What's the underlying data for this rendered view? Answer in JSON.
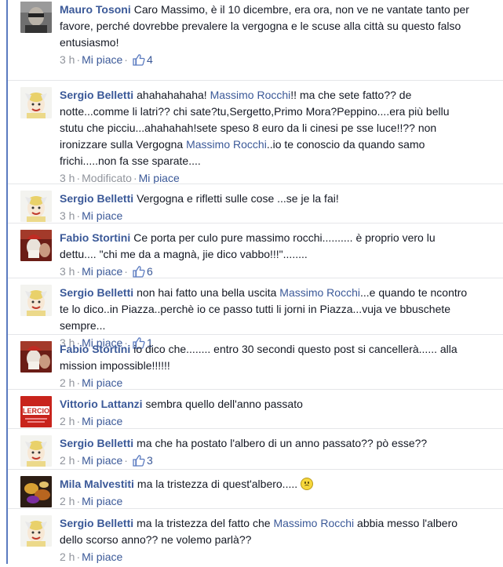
{
  "like_label": "Mi piace",
  "comments": [
    {
      "avatar": "mauro-avatar",
      "author": "Mauro Tosoni",
      "segments": [
        {
          "t": "Caro Massimo, è il 10 dicembre, era ora, non ve ne vantate tanto per favore, perché dovrebbe prevalere la vergogna e le scuse alla città su questo falso entusiasmo!",
          "m": false
        }
      ],
      "time": "3 h",
      "edited": "",
      "likes": "4"
    },
    {
      "avatar": "sergio-avatar",
      "author": "Sergio Belletti",
      "segments": [
        {
          "t": "ahahahahaha! ",
          "m": false
        },
        {
          "t": "Massimo Rocchi",
          "m": true
        },
        {
          "t": "!! ma che sete fatto?? de notte...comme li latri?? chi sate?tu,Sergetto,Primo Mora?Peppino....era più bellu stutu che picciu...ahahahah!sete speso 8 euro da li cinesi pe sse luce!!?? non ironizzare sulla Vergogna ",
          "m": false
        },
        {
          "t": "Massimo Rocchi",
          "m": true
        },
        {
          "t": "..io te conoscio da quando samo frichi.....non fa sse sparate....",
          "m": false
        }
      ],
      "time": "3 h",
      "edited": "Modificato",
      "likes": ""
    },
    {
      "avatar": "sergio-avatar",
      "author": "Sergio Belletti",
      "segments": [
        {
          "t": "Vergogna e rifletti sulle cose ...se je la fai!",
          "m": false
        }
      ],
      "time": "3 h",
      "edited": "",
      "likes": ""
    },
    {
      "avatar": "fabio-avatar",
      "author": "Fabio Stortini",
      "segments": [
        {
          "t": "Ce porta per culo pure massimo rocchi.......... è proprio vero lu dettu.... \"chi me da a magnà, jie dico vabbo!!!\"........",
          "m": false
        }
      ],
      "time": "3 h",
      "edited": "",
      "likes": "6"
    },
    {
      "avatar": "sergio-avatar",
      "author": "Sergio Belletti",
      "segments": [
        {
          "t": "non hai fatto una bella uscita ",
          "m": false
        },
        {
          "t": "Massimo Rocchi",
          "m": true
        },
        {
          "t": "...e quando te ncontro te lo dico..in Piazza..perchè io ce passo tutti li jorni in Piazza...vuja ve bbuschete sempre...",
          "m": false
        }
      ],
      "time": "3 h",
      "edited": "",
      "likes": "1"
    },
    {
      "avatar": "fabio-avatar",
      "author": "Fabio Stortini",
      "segments": [
        {
          "t": "io dico che........ entro 30 secondi questo post si cancellerà...... alla mission impossible!!!!!!",
          "m": false
        }
      ],
      "time": "2 h",
      "edited": "",
      "likes": ""
    },
    {
      "avatar": "vittorio-avatar",
      "author": "Vittorio Lattanzi",
      "segments": [
        {
          "t": "sembra quello dell'anno passato",
          "m": false
        }
      ],
      "time": "2 h",
      "edited": "",
      "likes": ""
    },
    {
      "avatar": "sergio-avatar",
      "author": "Sergio Belletti",
      "segments": [
        {
          "t": "ma che ha postato l'albero di un anno passato?? pò esse??",
          "m": false
        }
      ],
      "time": "2 h",
      "edited": "",
      "likes": "3"
    },
    {
      "avatar": "mila-avatar",
      "author": "Mila Malvestiti",
      "segments": [
        {
          "t": "ma la tristezza di quest'albero.....",
          "m": false
        }
      ],
      "emoji": "frown-emoji",
      "time": "2 h",
      "edited": "",
      "likes": ""
    },
    {
      "avatar": "sergio-avatar",
      "author": "Sergio Belletti",
      "segments": [
        {
          "t": "ma la tristezza del fatto che ",
          "m": false
        },
        {
          "t": "Massimo Rocchi",
          "m": true
        },
        {
          "t": " abbia messo l'albero dello scorso anno?? ne volemo parlà??",
          "m": false
        }
      ],
      "time": "2 h",
      "edited": "",
      "likes": ""
    }
  ],
  "vittorio_logo_text": "LERCIO"
}
